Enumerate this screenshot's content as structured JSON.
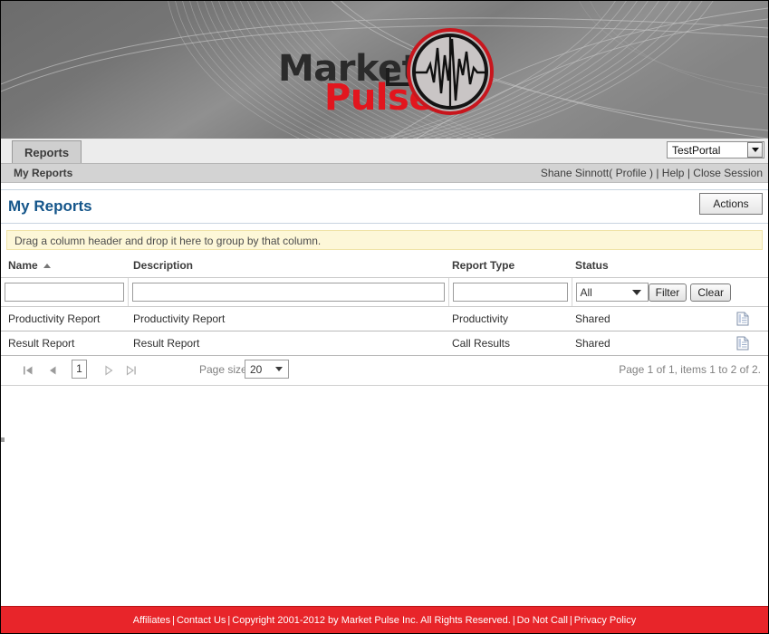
{
  "branding": {
    "logo_top": "Market",
    "logo_bottom": "Pulse",
    "logo_accent_color": "#e2161e",
    "banner_bg_color": "#808080"
  },
  "tabstrip": {
    "tabs": [
      {
        "label": "Reports",
        "active": true
      }
    ],
    "portal_select": {
      "value": "TestPortal",
      "caret_icon": "chevron-down-icon"
    }
  },
  "subbar": {
    "breadcrumb": "My Reports",
    "user_name": "Shane Sinnott",
    "profile_link": "( Profile )",
    "sep1": "|",
    "help_link": "Help",
    "sep2": "|",
    "close_session_link": "Close Session"
  },
  "page": {
    "title": "My Reports",
    "actions_label": "Actions",
    "group_hint": "Drag a column header and drop it here to group by that column."
  },
  "grid": {
    "columns": [
      {
        "label": "Name",
        "sorted": "asc",
        "sort_icon": "sort-ascending-icon"
      },
      {
        "label": "Description",
        "sorted": ""
      },
      {
        "label": "Report Type",
        "sorted": ""
      },
      {
        "label": "Status",
        "sorted": ""
      },
      {
        "label": "",
        "sorted": ""
      }
    ],
    "filters": {
      "name_value": "",
      "name_placeholder": "",
      "description_value": "",
      "description_placeholder": "",
      "report_type_value": "",
      "report_type_placeholder": "",
      "status_value": "All",
      "status_caret_icon": "chevron-down-icon",
      "filter_button": "Filter",
      "clear_button": "Clear"
    },
    "rows": [
      {
        "name": "Productivity Report",
        "description": "Productivity Report",
        "report_type": "Productivity",
        "status": "Shared",
        "action_icon": "document-icon"
      },
      {
        "name": "Result Report",
        "description": "Result Report",
        "report_type": "Call Results",
        "status": "Shared",
        "action_icon": "document-icon"
      }
    ]
  },
  "pager": {
    "first_icon": "first-page-icon",
    "prev_icon": "previous-page-icon",
    "current_page": "1",
    "next_icon": "next-page-icon",
    "last_icon": "last-page-icon",
    "page_size_label": "Page size",
    "page_size_value": "20",
    "page_size_caret_icon": "chevron-down-icon",
    "info": "Page 1 of 1, items 1 to 2 of 2."
  },
  "footer": {
    "affiliates": "Affiliates",
    "contact_us": "Contact Us",
    "copyright": "Copyright 2001-2012 by Market Pulse Inc. All Rights Reserved.",
    "do_not_call": "Do Not Call",
    "privacy_policy": "Privacy Policy",
    "separator": "|",
    "bg_color": "#e8252a"
  }
}
